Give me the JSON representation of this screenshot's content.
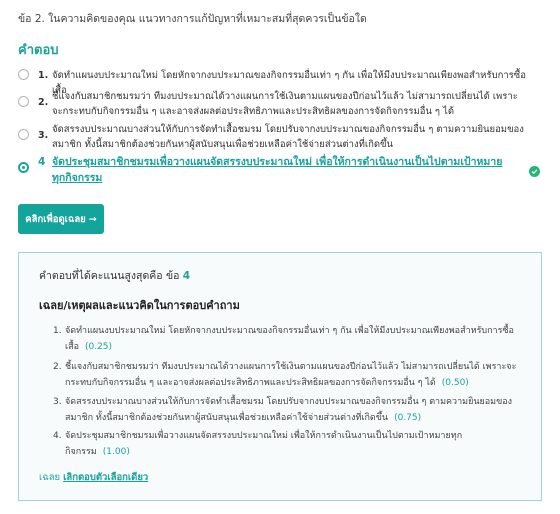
{
  "question": "ข้อ 2. ในความคิดของคุณ แนวทางการแก้ปัญหาที่เหมาะสมที่สุดควรเป็นข้อใด",
  "answers_heading": "คำตอบ",
  "options": [
    {
      "num": "1.",
      "text": "จัดทำแผนงบประมาณใหม่ โดยหักจากงบประมาณของกิจกรรมอื่นเท่า ๆ กัน เพื่อให้มีงบประมาณเพียงพอสำหรับการซื้อเสื้อ",
      "selected": false
    },
    {
      "num": "2.",
      "text": "ชี้แจงกับสมาชิกชมรมว่า ทีมงบประมาณได้วางแผนการใช้เงินตามแผนของปีก่อนไว้แล้ว ไม่สามารถเปลี่ยนได้ เพราะจะกระทบกับกิจกรรมอื่น ๆ และอาจส่งผลต่อประสิทธิภาพและประสิทธิผลของการจัดกิจกรรมอื่น ๆ ได้",
      "selected": false
    },
    {
      "num": "3.",
      "text": "จัดสรรงบประมาณบางส่วนให้กับการจัดทำเสื้อชมรม โดยปรับจากงบประมาณของกิจกรรมอื่น ๆ ตามความยินยอมของสมาชิก ทั้งนี้สมาชิกต้องช่วยกันหาผู้สนับสนุนเพื่อช่วยเหลือค่าใช้จ่ายส่วนต่างที่เกิดขึ้น",
      "selected": false
    },
    {
      "num": "4",
      "text": "จัดประชุมสมาชิกชมรมเพื่อวางแผนจัดสรรงบประมาณใหม่ เพื่อให้การดำเนินงานเป็นไปตามเป้าหมายทุกกิจกรรม",
      "selected": true
    }
  ],
  "cta_label": "คลิกเพื่อดูเฉลย",
  "cta_arrow": "→",
  "best": {
    "prefix": "คำตอบที่ได้คะแนนสูงสุดคือ ข้อ",
    "value": "4"
  },
  "reason_title": "เฉลย/เหตุผลและแนวคิดในการตอบคำถาม",
  "reasons": [
    {
      "num": "1.",
      "text": "จัดทำแผนงบประมาณใหม่ โดยหักจากงบประมาณของกิจกรรมอื่นเท่า ๆ กัน เพื่อให้มีงบประมาณเพียงพอสำหรับการซื้อเสื้อ",
      "score": "(0.25)"
    },
    {
      "num": "2.",
      "text": "ชี้แจงกับสมาชิกชมรมว่า ทีมงบประมาณได้วางแผนการใช้เงินตามแผนของปีก่อนไว้แล้ว ไม่สามารถเปลี่ยนได้ เพราะจะกระทบกับกิจกรรมอื่น ๆ และอาจส่งผลต่อประสิทธิภาพและประสิทธิผลของการจัดกิจกรรมอื่น ๆ ได้",
      "score": "(0.50)"
    },
    {
      "num": "3.",
      "text": "จัดสรรงบประมาณบางส่วนให้กับการจัดทำเสื้อชมรม โดยปรับจากงบประมาณของกิจกรรมอื่น ๆ ตามความยินยอมของสมาชิก ทั้งนี้สมาชิกต้องช่วยกันหาผู้สนับสนุนเพื่อช่วยเหลือค่าใช้จ่ายส่วนต่างที่เกิดขึ้น",
      "score": "(0.75)"
    },
    {
      "num": "4.",
      "text": "จัดประชุมสมาชิกชมรมเพื่อวางแผนจัดสรรงบประมาณใหม่ เพื่อให้การดำเนินงานเป็นไปตามเป้าหมายทุกกิจกรรม",
      "score": "(1.00)"
    }
  ],
  "answer_line": {
    "prefix": "เฉลย",
    "link": "เลิกตอบตัวเลือกเดียว"
  },
  "colors": {
    "accent": "#1aa39b",
    "correct_check": "#22b573",
    "button": "#13a49b"
  },
  "icons": {
    "correct": "check-circle-icon",
    "arrow": "arrow-right-icon"
  }
}
